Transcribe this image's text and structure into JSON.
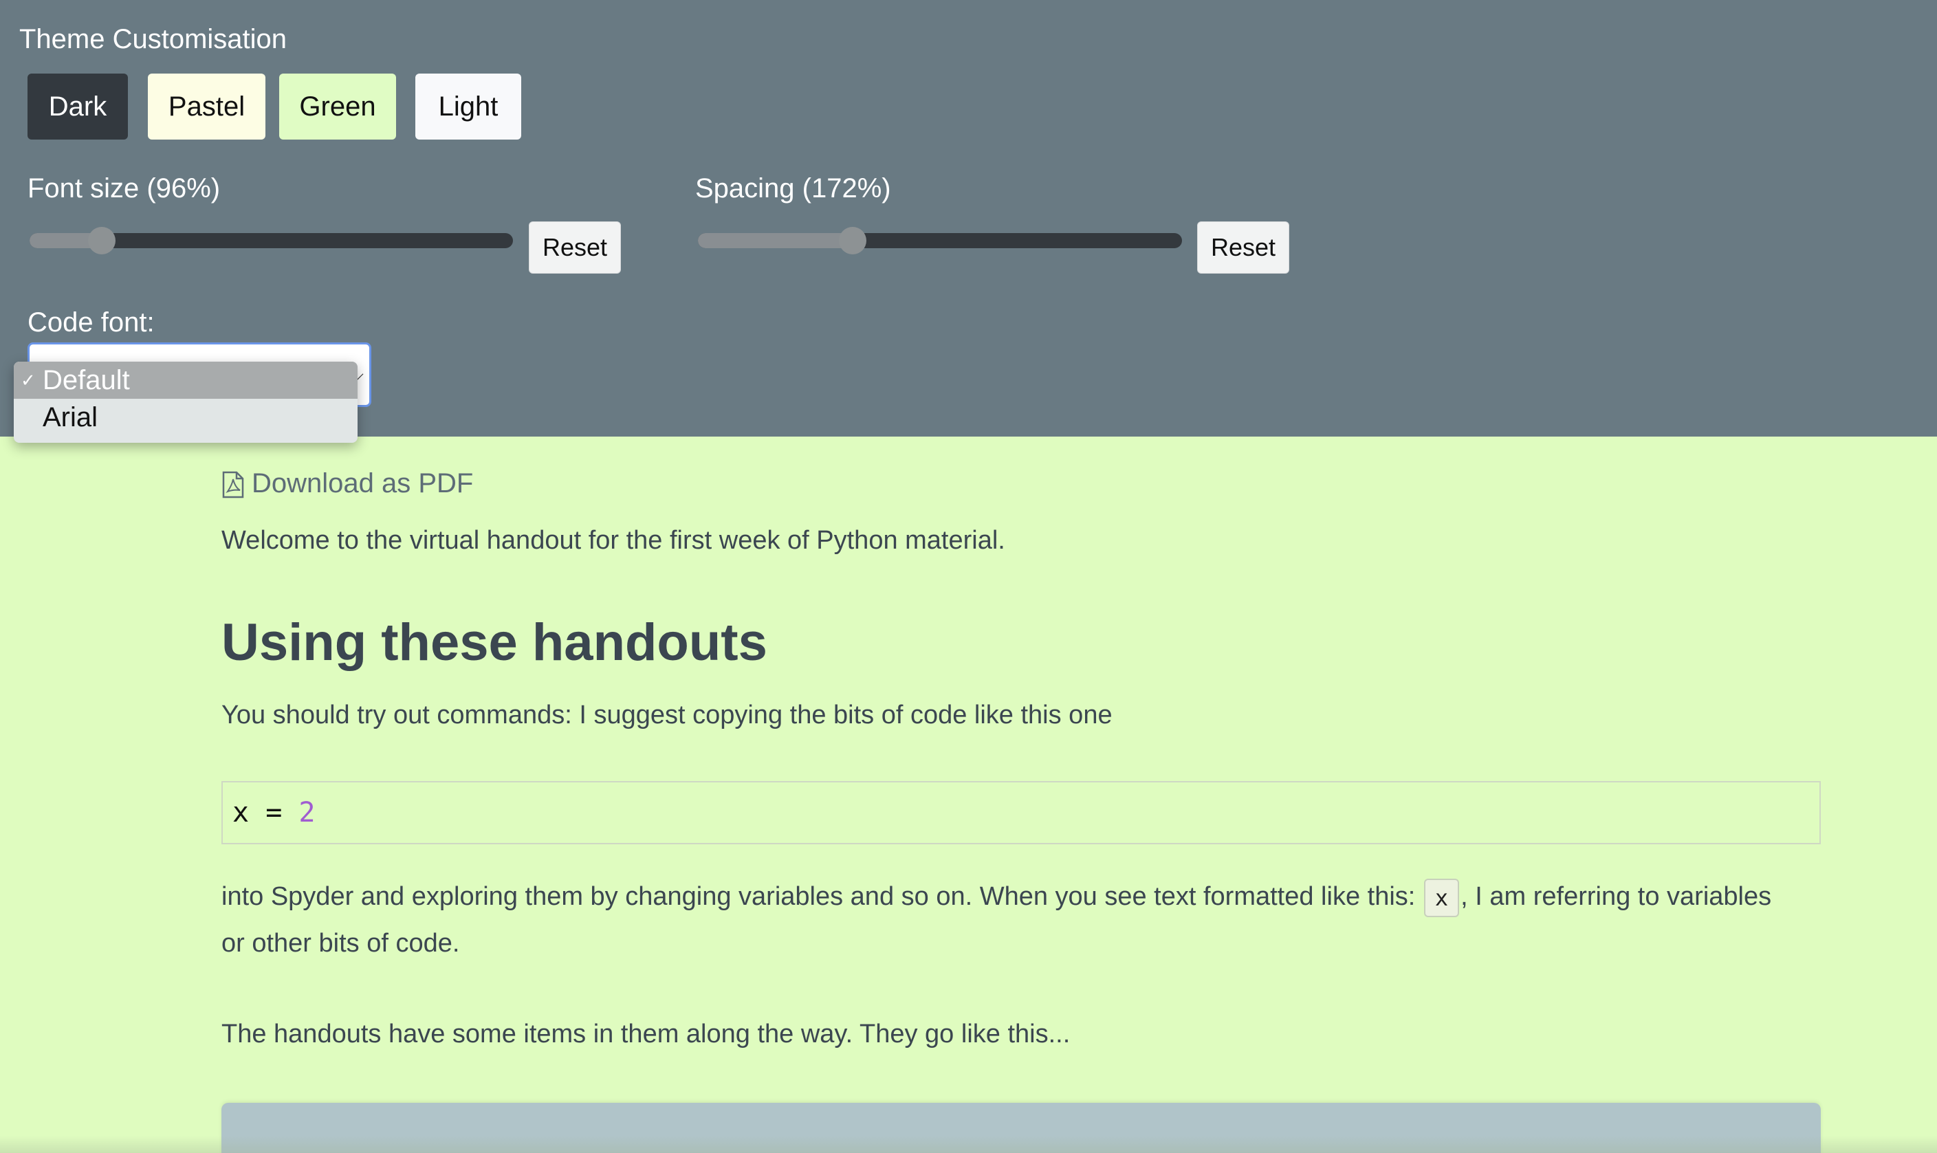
{
  "theme_panel": {
    "title": "Theme Customisation",
    "theme_buttons": {
      "dark": "Dark",
      "pastel": "Pastel",
      "green": "Green",
      "light": "Light"
    },
    "font_size": {
      "label": "Font size (96%)",
      "value_percent": 96,
      "slider_position": 0.15,
      "reset_label": "Reset"
    },
    "spacing": {
      "label": "Spacing (172%)",
      "value_percent": 172,
      "slider_position": 0.32,
      "reset_label": "Reset"
    },
    "code_font": {
      "label": "Code font:",
      "options": [
        "Default",
        "Arial"
      ],
      "selected": "Default",
      "check_mark": "✓"
    }
  },
  "content": {
    "download_link": "Download as PDF",
    "intro": "Welcome to the virtual handout for the first week of Python material.",
    "heading": "Using these handouts",
    "para1": "You should try out commands: I suggest copying the bits of code like this one",
    "code": {
      "var": "x",
      "op": "=",
      "num": "2"
    },
    "para2_before": "into Spyder and exploring them by changing variables and so on. When you see text formatted like this: ",
    "para2_code": "x",
    "para2_after": ", I am referring to variables",
    "para2_line2": "or other bits of code.",
    "para3": "The handouts have some items in them along the way. They go like this..."
  },
  "colors": {
    "panel_bg": "#697a83",
    "content_bg": "#dffcbf",
    "code_number": "#a05cd1",
    "select_focus": "#6a95e8"
  },
  "icons": [
    "pdf-file-icon",
    "chevron-down-icon",
    "checkmark-icon"
  ]
}
